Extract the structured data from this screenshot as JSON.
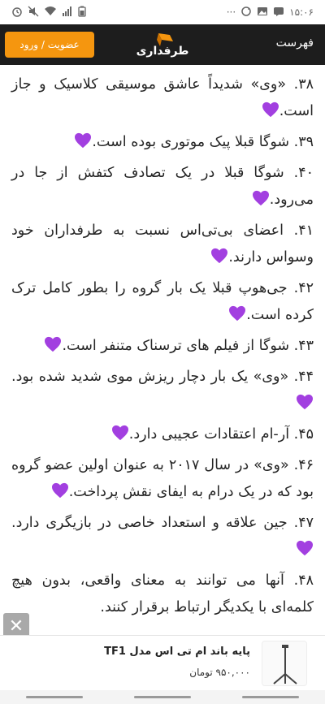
{
  "status_bar": {
    "time": "۱۵:۰۶",
    "dots": "···"
  },
  "header": {
    "auth_label": "عضویت / ورود",
    "logo_text": "طرفداری",
    "menu_label": "فهرست",
    "accent_color": "#f5960f",
    "background_color": "#1d1d1d"
  },
  "content": {
    "heart_color": "#a23fe0",
    "facts": [
      {
        "text": "۳۸. «وی» شدیداً عاشق موسیقی کلاسیک و جاز است.",
        "heart": true
      },
      {
        "text": "۳۹. شوگا قبلا پیک موتوری بوده است.",
        "heart": true
      },
      {
        "text": "۴۰. شوگا قبلا در یک تصادف کتفش از جا در می‌رود.",
        "heart": true
      },
      {
        "text": "۴۱. اعضای بی‌تی‌اس نسبت به طرفداران خود وسواس دارند.",
        "heart": true
      },
      {
        "text": "۴۲. جی‌هوپ قبلا یک بار گروه را بطور کامل ترک کرده است.",
        "heart": true
      },
      {
        "text": "۴۳. شوگا از فیلم های ترسناک متنفر است.",
        "heart": true
      },
      {
        "text": "۴۴. «وی» یک بار دچار ریزش موی شدید شده بود.",
        "heart": true
      },
      {
        "text": "۴۵. آر-ام اعتقادات عجیبی دارد.",
        "heart": true
      },
      {
        "text": "۴۶. «وی» در سال ۲۰۱۷ به عنوان اولین عضو گروه بود که در یک درام به ایفای نقش پرداخت.",
        "heart": true
      },
      {
        "text": "۴۷. جین علاقه و استعداد خاصی در بازیگری دارد.",
        "heart": true
      },
      {
        "text": "۴۸. آنها می توانند به معنای واقعی، بدون هیچ کلمه‌ای با یکدیگر ارتباط برقرار کنند.",
        "heart": false
      }
    ]
  },
  "ad": {
    "close_glyph": "✕",
    "title": "پایه باند ام تی اس مدل TF1",
    "price": "۹۵۰,۰۰۰ تومان"
  }
}
